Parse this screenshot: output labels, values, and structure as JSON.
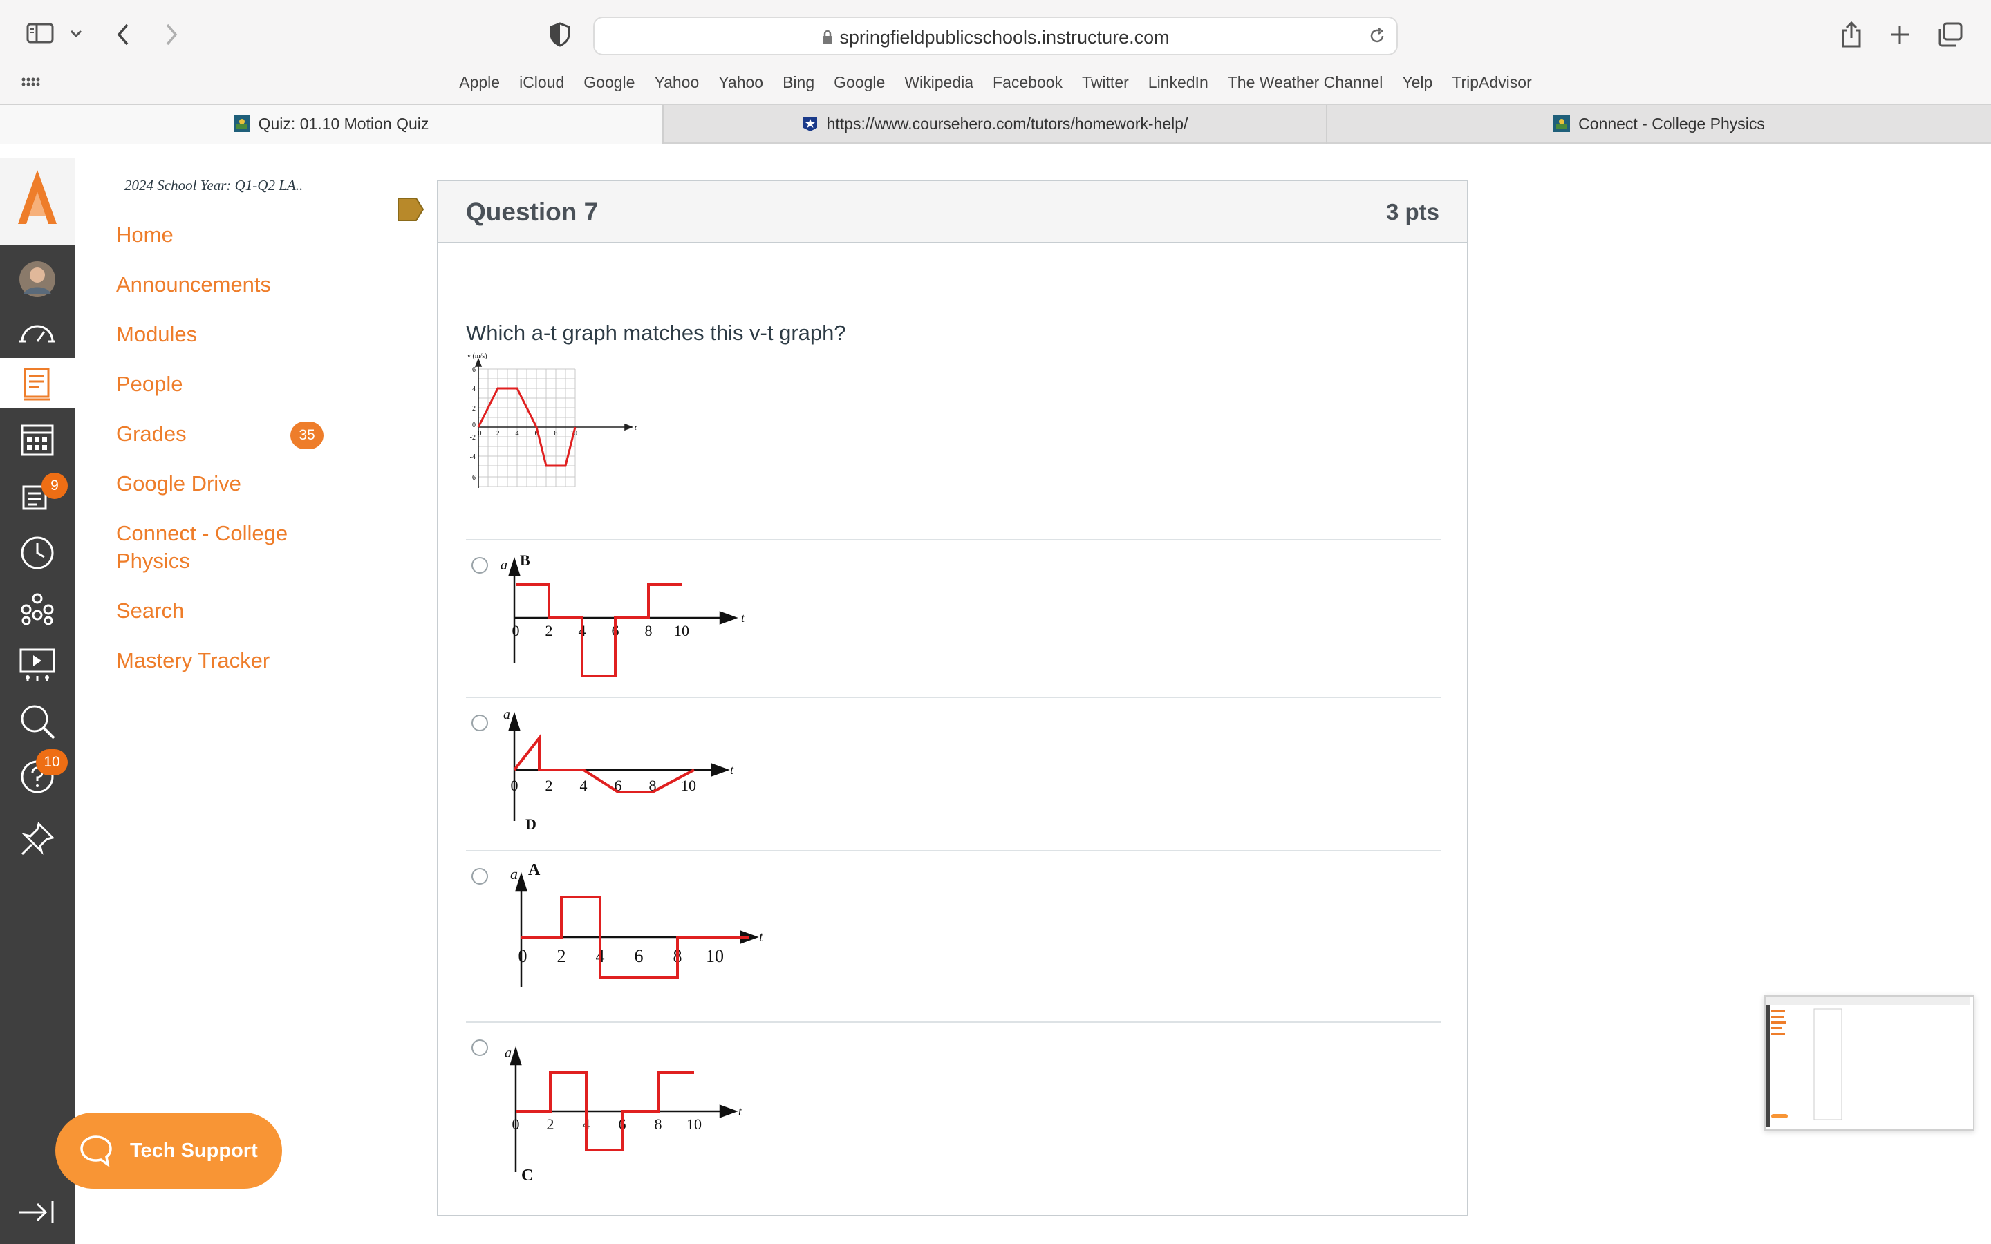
{
  "browser": {
    "url": "springfieldpublicschools.instructure.com",
    "bookmarks": [
      "Apple",
      "iCloud",
      "Google",
      "Yahoo",
      "Yahoo",
      "Bing",
      "Google",
      "Wikipedia",
      "Facebook",
      "Twitter",
      "LinkedIn",
      "The Weather Channel",
      "Yelp",
      "TripAdvisor"
    ],
    "tabs": [
      {
        "title": "Quiz: 01.10 Motion Quiz",
        "active": true
      },
      {
        "title": "https://www.coursehero.com/tutors/homework-help/",
        "active": false
      },
      {
        "title": "Connect - College Physics",
        "active": false
      }
    ]
  },
  "global_nav": {
    "badges": {
      "inbox": "9",
      "help": "10"
    },
    "items": [
      "account",
      "dashboard",
      "courses",
      "calendar",
      "inbox",
      "history",
      "groups",
      "studio",
      "search",
      "help",
      "pin",
      "collapse"
    ],
    "accent": "#ee7d2a"
  },
  "course": {
    "breadcrumb": "2024 School Year: Q1-Q2 LA..",
    "nav": [
      {
        "label": "Home"
      },
      {
        "label": "Announcements"
      },
      {
        "label": "Modules"
      },
      {
        "label": "People"
      },
      {
        "label": "Grades",
        "badge": "35"
      },
      {
        "label": "Google Drive"
      },
      {
        "label": "Connect - College Physics"
      },
      {
        "label": "Search"
      },
      {
        "label": "Mastery Tracker"
      }
    ]
  },
  "tech_support": "Tech Support",
  "question": {
    "title": "Question 7",
    "points": "3 pts",
    "text": "Which a-t graph matches this v-t graph?",
    "vt_graph": {
      "ylabel": "v (m/s)",
      "xlabel": "t",
      "y_ticks": [
        "6",
        "4",
        "2",
        "0",
        "-2",
        "-4",
        "-6"
      ],
      "x_ticks": [
        "0",
        "2",
        "4",
        "6",
        "8",
        "10"
      ]
    },
    "options": [
      {
        "letter": "B",
        "ylabel": "a",
        "xlabel": "t",
        "x_ticks": [
          "0",
          "2",
          "4",
          "6",
          "8",
          "10"
        ]
      },
      {
        "letter": "D",
        "ylabel": "a",
        "xlabel": "t",
        "x_ticks": [
          "0",
          "2",
          "4",
          "6",
          "8",
          "10"
        ]
      },
      {
        "letter": "A",
        "ylabel": "a",
        "xlabel": "t",
        "x_ticks": [
          "0",
          "2",
          "4",
          "6",
          "8",
          "10"
        ]
      },
      {
        "letter": "C",
        "ylabel": "a",
        "xlabel": "t",
        "x_ticks": [
          "0",
          "2",
          "4",
          "6",
          "8",
          "10"
        ]
      }
    ]
  }
}
